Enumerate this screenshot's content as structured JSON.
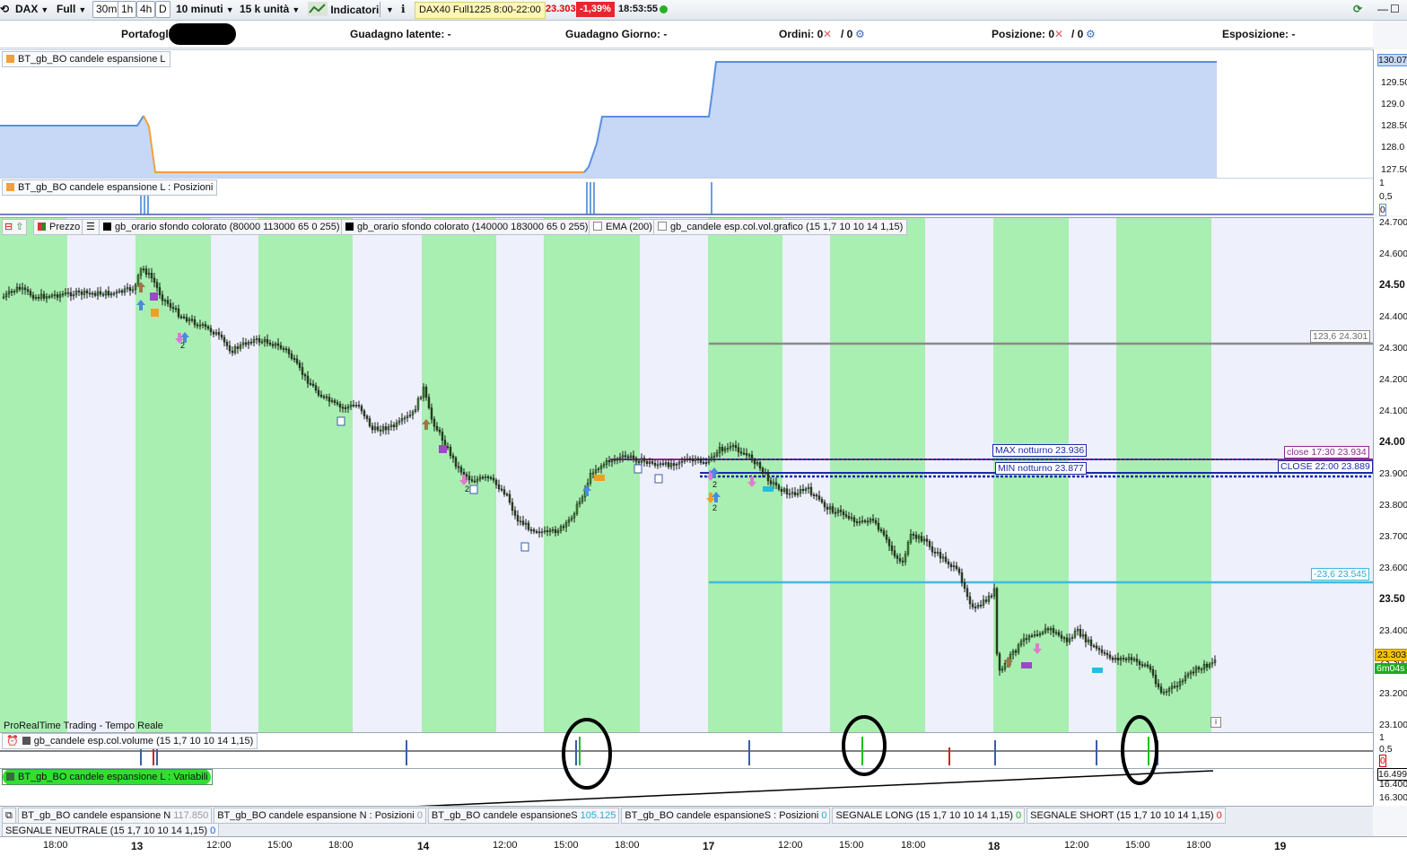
{
  "toolbar": {
    "instrument": "DAX",
    "mode": "Full",
    "tf": [
      "30m",
      "1h",
      "4h",
      "D"
    ],
    "interval": "10 minuti",
    "units": "15 k unità",
    "indicators": "Indicatori",
    "symbol_label": "DAX40 Full1225 8:00-22:00",
    "price": "23.303",
    "change": "-1,39%",
    "clock": "18:53:55"
  },
  "portfolio": {
    "portafoglio": "Portafoglio",
    "guadagno_latente": "Guadagno latente: -",
    "guadagno_giorno": "Guadagno Giorno: -",
    "ordini": "Ordini: 0",
    "ordini_b": "/ 0",
    "posizione": "Posizione: 0",
    "posizione_b": "/ 0",
    "esposizione": "Esposizione: -"
  },
  "equity_panel": {
    "title": "BT_gb_BO candele espansione L",
    "axis": [
      "130.07",
      "129.50",
      "129.0",
      "128.50",
      "128.0",
      "127.50"
    ]
  },
  "positions_panel": {
    "title": "BT_gb_BO candele espansione L : Posizioni",
    "axis": [
      "1",
      "0,5",
      "0"
    ]
  },
  "price_panel": {
    "legend": [
      "Prezzo",
      "gb_orario sfondo colorato (80000 113000 65 0 255)",
      "gb_orario sfondo colorato (140000 183000 65 0 255)",
      "EMA (200)",
      "gb_candele esp.col.vol.grafico (15 1,7 10 10 14 1,15)"
    ],
    "footer": "ProRealTime Trading - Tempo Reale",
    "axis": [
      "24.700",
      "24.600",
      "24.50",
      "24.400",
      "24.300",
      "24.200",
      "24.100",
      "24.00",
      "23.900",
      "23.800",
      "23.700",
      "23.600",
      "23.50",
      "23.400",
      "23.300",
      "23.200",
      "23.100"
    ],
    "last_price": "23.303",
    "countdown": "6m04s",
    "levels": {
      "fib_up": "123,6 24.301",
      "fib_down": "-23,6 23.545",
      "max_notturno": "MAX notturno 23.936",
      "min_notturno": "MIN notturno 23.877",
      "close_1730": "close 17:30 23.934",
      "close_2200": "CLOSE 22:00 23.889"
    },
    "marker_labels": [
      "2",
      "2",
      "2",
      "2"
    ]
  },
  "volume_panel": {
    "title": "gb_candele esp.col.volume (15 1,7 10 10 14 1,15)",
    "axis": [
      "1",
      "0,5",
      "0"
    ]
  },
  "variables_panel": {
    "title": "BT_gb_BO candele espansione L : Variabili",
    "axis": [
      "16.499",
      "16.400",
      "16.300"
    ]
  },
  "bottom": {
    "row1": [
      {
        "label": "BT_gb_BO candele espansione N",
        "val": "117.850",
        "color": "#9a9a9a"
      },
      {
        "label": "BT_gb_BO candele espansione N : Posizioni",
        "val": "0",
        "color": "#9a9a9a"
      },
      {
        "label": "BT_gb_BO candele espansioneS",
        "val": "105.125",
        "color": "#2aa9d6"
      },
      {
        "label": "BT_gb_BO candele espansioneS : Posizioni",
        "val": "0",
        "color": "#2aa9d6"
      },
      {
        "label": "SEGNALE LONG (15 1,7 10 10 14 1,15)",
        "val": "0",
        "color": "#1fa51f"
      },
      {
        "label": "SEGNALE SHORT (15 1,7 10 10 14 1,15)",
        "val": "0",
        "color": "#d31f1f"
      }
    ],
    "row2": [
      {
        "label": "SEGNALE NEUTRALE (15 1,7 10 10 14 1,15)",
        "val": "0",
        "color": "#1f5fd3"
      }
    ]
  },
  "xaxis": [
    {
      "t": "18:00",
      "b": false
    },
    {
      "t": "13",
      "b": true
    },
    {
      "t": "12:00",
      "b": false
    },
    {
      "t": "15:00",
      "b": false
    },
    {
      "t": "18:00",
      "b": false
    },
    {
      "t": "14",
      "b": true
    },
    {
      "t": "12:00",
      "b": false
    },
    {
      "t": "15:00",
      "b": false
    },
    {
      "t": "18:00",
      "b": false
    },
    {
      "t": "17",
      "b": true
    },
    {
      "t": "12:00",
      "b": false
    },
    {
      "t": "15:00",
      "b": false
    },
    {
      "t": "18:00",
      "b": false
    },
    {
      "t": "18",
      "b": true
    },
    {
      "t": "12:00",
      "b": false
    },
    {
      "t": "15:00",
      "b": false
    },
    {
      "t": "18:00",
      "b": false
    },
    {
      "t": "19",
      "b": true
    }
  ]
}
